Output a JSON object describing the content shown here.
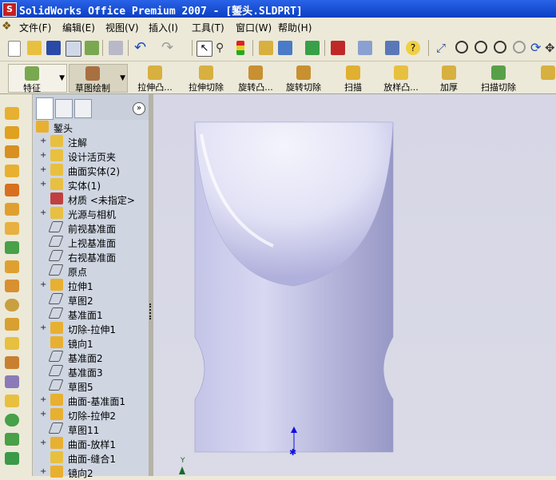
{
  "window": {
    "title": "SolidWorks Office Premium 2007 - [錾头.SLDPRT]"
  },
  "menubar": {
    "items": [
      {
        "label": "文件(F)"
      },
      {
        "label": "编辑(E)"
      },
      {
        "label": "视图(V)"
      },
      {
        "label": "插入(I)"
      },
      {
        "label": "工具(T)"
      },
      {
        "label": "窗口(W)"
      },
      {
        "label": "帮助(H)"
      }
    ]
  },
  "command_manager": {
    "tabs": [
      {
        "label": "特征"
      },
      {
        "label": "草图绘制"
      }
    ],
    "buttons": [
      {
        "label": "拉伸凸..."
      },
      {
        "label": "拉伸切除"
      },
      {
        "label": "旋转凸..."
      },
      {
        "label": "旋转切除"
      },
      {
        "label": "扫描"
      },
      {
        "label": "放样凸..."
      },
      {
        "label": "加厚"
      },
      {
        "label": "扫描切除"
      }
    ]
  },
  "feature_tree": {
    "root": "錾头",
    "items": [
      {
        "label": "注解",
        "icon": "annotation-icon",
        "expandable": true
      },
      {
        "label": "设计活页夹",
        "icon": "design-binder-icon",
        "expandable": true
      },
      {
        "label": "曲面实体(2)",
        "icon": "surface-bodies-icon",
        "expandable": true
      },
      {
        "label": "实体(1)",
        "icon": "solid-bodies-icon",
        "expandable": true
      },
      {
        "label": "材质 <未指定>",
        "icon": "material-icon",
        "expandable": false
      },
      {
        "label": "光源与相机",
        "icon": "lights-camera-icon",
        "expandable": true
      },
      {
        "label": "前视基准面",
        "icon": "plane-icon",
        "expandable": false
      },
      {
        "label": "上视基准面",
        "icon": "plane-icon",
        "expandable": false
      },
      {
        "label": "右视基准面",
        "icon": "plane-icon",
        "expandable": false
      },
      {
        "label": "原点",
        "icon": "origin-icon",
        "expandable": false
      },
      {
        "label": "拉伸1",
        "icon": "extrude-icon",
        "expandable": true
      },
      {
        "label": "草图2",
        "icon": "sketch-icon",
        "expandable": false
      },
      {
        "label": "基准面1",
        "icon": "plane-icon",
        "expandable": false
      },
      {
        "label": "切除-拉伸1",
        "icon": "cut-extrude-icon",
        "expandable": true
      },
      {
        "label": "镜向1",
        "icon": "mirror-icon",
        "expandable": false
      },
      {
        "label": "基准面2",
        "icon": "plane-icon",
        "expandable": false
      },
      {
        "label": "基准面3",
        "icon": "plane-icon",
        "expandable": false
      },
      {
        "label": "草图5",
        "icon": "sketch-icon",
        "expandable": false
      },
      {
        "label": "曲面-基准面1",
        "icon": "planar-surface-icon",
        "expandable": true
      },
      {
        "label": "切除-拉伸2",
        "icon": "cut-extrude-icon",
        "expandable": true
      },
      {
        "label": "草图11",
        "icon": "sketch-icon",
        "expandable": false
      },
      {
        "label": "曲面-放样1",
        "icon": "surface-loft-icon",
        "expandable": true
      },
      {
        "label": "曲面-缝合1",
        "icon": "surface-knit-icon",
        "expandable": false
      },
      {
        "label": "镜向2",
        "icon": "mirror-icon",
        "expandable": true
      }
    ]
  },
  "viewport": {
    "triad_axis_label": "Y"
  },
  "colors": {
    "title_bar": "#0a3ec2",
    "tree_bg": "#cfd6e2",
    "model_fill": "#c8c8ea",
    "viewport_bg": "#d6d6e6"
  }
}
